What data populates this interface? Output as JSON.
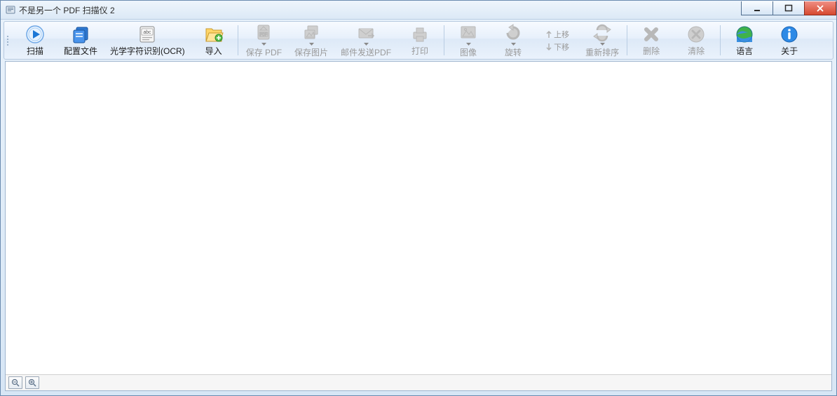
{
  "window": {
    "title": "不是另一个 PDF 扫描仪 2"
  },
  "toolbar": {
    "scan": "扫描",
    "profiles": "配置文件",
    "ocr": "光学字符识别(OCR)",
    "import": "导入",
    "save_pdf": "保存 PDF",
    "save_image": "保存图片",
    "email_pdf": "邮件发送PDF",
    "print": "打印",
    "image": "图像",
    "rotate": "旋转",
    "move_up": "上移",
    "move_down": "下移",
    "reorder": "重新排序",
    "delete": "删除",
    "clear": "清除",
    "language": "语言",
    "about": "关于"
  }
}
